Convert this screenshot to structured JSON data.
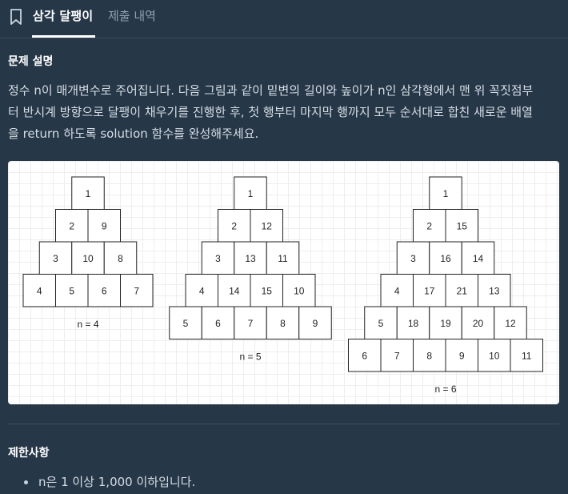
{
  "header": {
    "active_tab": "삼각 달팽이",
    "inactive_tab": "제출 내역",
    "bookmark_icon": "bookmark-icon"
  },
  "description": {
    "title": "문제 설명",
    "lines": [
      "정수 n이 매개변수로 주어집니다. 다음 그림과 같이 밑변의 길이와 높이가 n인 삼각형에서 맨 위 꼭짓점부",
      "터 반시계 방향으로 달팽이 채우기를 진행한 후, 첫 행부터 마지막 행까지 모두 순서대로 합친 새로운 배열",
      "을 return 하도록 solution 함수를 완성해주세요."
    ]
  },
  "figure": {
    "triangles": [
      {
        "label": "n = 4",
        "rows": [
          [
            1
          ],
          [
            2,
            9
          ],
          [
            3,
            10,
            8
          ],
          [
            4,
            5,
            6,
            7
          ]
        ]
      },
      {
        "label": "n = 5",
        "rows": [
          [
            1
          ],
          [
            2,
            12
          ],
          [
            3,
            13,
            11
          ],
          [
            4,
            14,
            15,
            10
          ],
          [
            5,
            6,
            7,
            8,
            9
          ]
        ]
      },
      {
        "label": "n = 6",
        "rows": [
          [
            1
          ],
          [
            2,
            15
          ],
          [
            3,
            16,
            14
          ],
          [
            4,
            17,
            21,
            13
          ],
          [
            5,
            18,
            19,
            20,
            12
          ],
          [
            6,
            7,
            8,
            9,
            10,
            11
          ]
        ]
      }
    ]
  },
  "constraints": {
    "title": "제한사항",
    "items": [
      "n은 1 이상 1,000 이하입니다."
    ]
  }
}
